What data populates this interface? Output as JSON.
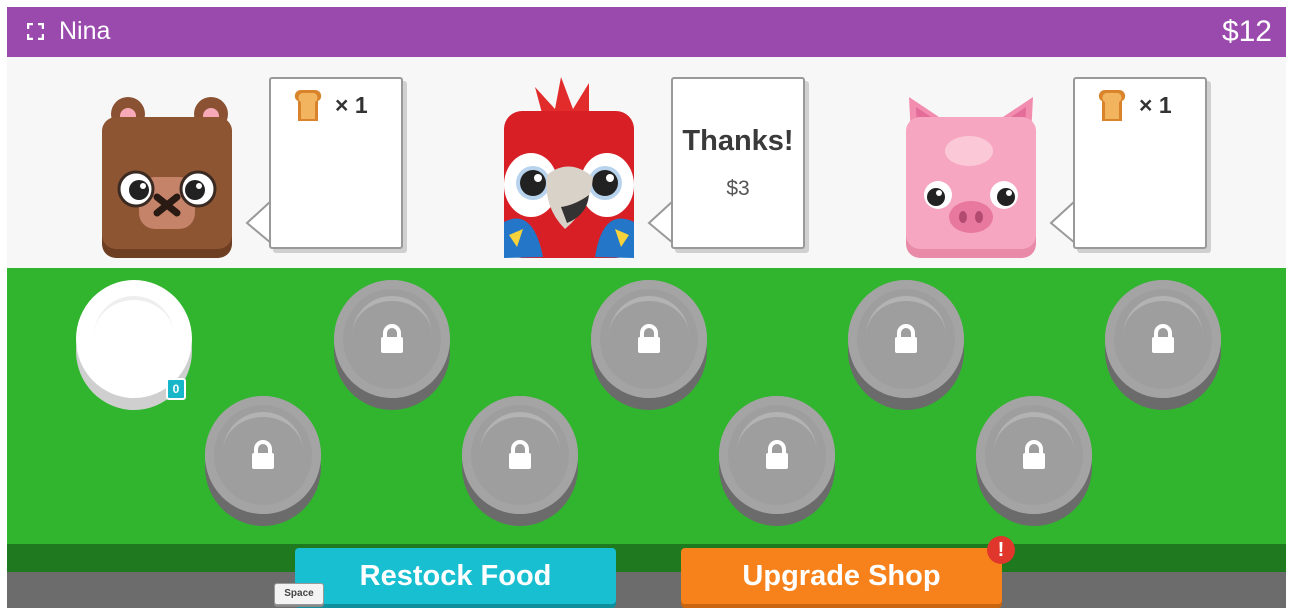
{
  "header": {
    "player_name": "Nina",
    "money": "$12",
    "fullscreen_icon": "fullscreen-icon",
    "bar_color": "#9a4aad"
  },
  "customers": [
    {
      "animal": "bear",
      "order_item": "toast",
      "order_text": "× 1"
    },
    {
      "animal": "parrot",
      "message": "Thanks!",
      "tip": "$3"
    },
    {
      "animal": "pig",
      "order_item": "toast",
      "order_text": "× 1"
    }
  ],
  "plates": {
    "first_plate_count": "0",
    "locked_icon": "lock-icon"
  },
  "buttons": {
    "restock_label": "Restock Food",
    "restock_hotkey": "Space",
    "upgrade_label": "Upgrade Shop",
    "upgrade_alert": "!",
    "restock_color": "#18bfd1",
    "upgrade_color": "#f7821b"
  },
  "colors": {
    "counter": "#31b52e",
    "counter_edge": "#1f7a1f"
  }
}
